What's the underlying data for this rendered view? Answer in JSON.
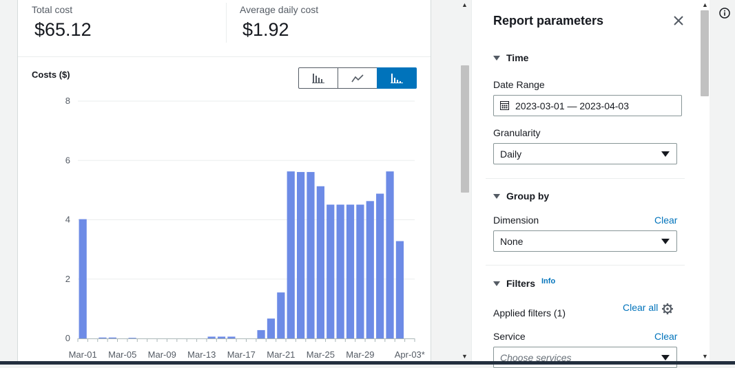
{
  "summary": {
    "total_cost_label": "Total cost",
    "total_cost_value": "$65.12",
    "avg_daily_label": "Average daily cost",
    "avg_daily_value": "$1.92"
  },
  "chart": {
    "title": "Costs ($)",
    "chart_types": [
      {
        "icon": "bar-chart-icon",
        "selected": false
      },
      {
        "icon": "line-chart-icon",
        "selected": false
      },
      {
        "icon": "stacked-bar-chart-icon",
        "selected": true
      }
    ],
    "accent_color": "#0073bb",
    "bar_color": "#6d8be6"
  },
  "chart_data": {
    "type": "bar",
    "title": "Costs ($)",
    "xlabel": "",
    "ylabel": "Costs ($)",
    "ylim": [
      0,
      8
    ],
    "yticks": [
      0,
      2,
      4,
      6,
      8
    ],
    "grid": true,
    "xtick_labels": [
      "Mar-01",
      "Mar-05",
      "Mar-09",
      "Mar-13",
      "Mar-17",
      "Mar-21",
      "Mar-25",
      "Mar-29",
      "Apr-03*"
    ],
    "categories": [
      "Mar-01",
      "Mar-02",
      "Mar-03",
      "Mar-04",
      "Mar-05",
      "Mar-06",
      "Mar-07",
      "Mar-08",
      "Mar-09",
      "Mar-10",
      "Mar-11",
      "Mar-12",
      "Mar-13",
      "Mar-14",
      "Mar-15",
      "Mar-16",
      "Mar-17",
      "Mar-18",
      "Mar-19",
      "Mar-20",
      "Mar-21",
      "Mar-22",
      "Mar-23",
      "Mar-24",
      "Mar-25",
      "Mar-26",
      "Mar-27",
      "Mar-28",
      "Mar-29",
      "Mar-30",
      "Mar-31",
      "Apr-01",
      "Apr-02",
      "Apr-03*"
    ],
    "values": [
      4.02,
      0,
      0.03,
      0.03,
      0,
      0.02,
      0,
      0,
      0,
      0,
      0,
      0,
      0,
      0.06,
      0.06,
      0.06,
      0,
      0,
      0.28,
      0.67,
      1.55,
      5.63,
      5.61,
      5.61,
      5.13,
      4.51,
      4.51,
      4.51,
      4.51,
      4.63,
      4.88,
      5.63,
      3.28,
      0
    ]
  },
  "panel": {
    "title": "Report parameters",
    "time_section": "Time",
    "date_range_label": "Date Range",
    "date_range_value": "2023-03-01 — 2023-04-03",
    "granularity_label": "Granularity",
    "granularity_value": "Daily",
    "group_by_section": "Group by",
    "dimension_label": "Dimension",
    "dimension_clear": "Clear",
    "dimension_value": "None",
    "filters_section": "Filters",
    "filters_info": "Info",
    "applied_filters_label": "Applied filters (1)",
    "clear_all": "Clear all",
    "service_label": "Service",
    "service_clear": "Clear",
    "service_placeholder": "Choose services"
  }
}
